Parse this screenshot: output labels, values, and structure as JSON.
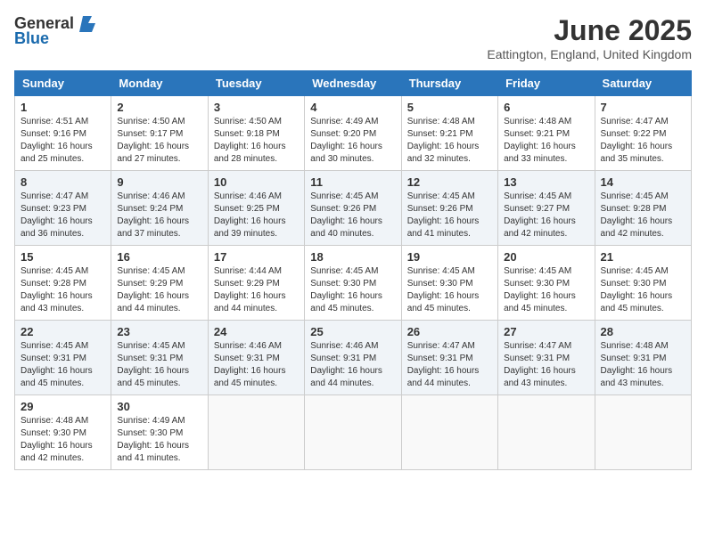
{
  "header": {
    "logo_general": "General",
    "logo_blue": "Blue",
    "month_year": "June 2025",
    "location": "Eattington, England, United Kingdom"
  },
  "weekdays": [
    "Sunday",
    "Monday",
    "Tuesday",
    "Wednesday",
    "Thursday",
    "Friday",
    "Saturday"
  ],
  "weeks": [
    [
      {
        "day": "1",
        "info": "Sunrise: 4:51 AM\nSunset: 9:16 PM\nDaylight: 16 hours and 25 minutes."
      },
      {
        "day": "2",
        "info": "Sunrise: 4:50 AM\nSunset: 9:17 PM\nDaylight: 16 hours and 27 minutes."
      },
      {
        "day": "3",
        "info": "Sunrise: 4:50 AM\nSunset: 9:18 PM\nDaylight: 16 hours and 28 minutes."
      },
      {
        "day": "4",
        "info": "Sunrise: 4:49 AM\nSunset: 9:20 PM\nDaylight: 16 hours and 30 minutes."
      },
      {
        "day": "5",
        "info": "Sunrise: 4:48 AM\nSunset: 9:21 PM\nDaylight: 16 hours and 32 minutes."
      },
      {
        "day": "6",
        "info": "Sunrise: 4:48 AM\nSunset: 9:21 PM\nDaylight: 16 hours and 33 minutes."
      },
      {
        "day": "7",
        "info": "Sunrise: 4:47 AM\nSunset: 9:22 PM\nDaylight: 16 hours and 35 minutes."
      }
    ],
    [
      {
        "day": "8",
        "info": "Sunrise: 4:47 AM\nSunset: 9:23 PM\nDaylight: 16 hours and 36 minutes."
      },
      {
        "day": "9",
        "info": "Sunrise: 4:46 AM\nSunset: 9:24 PM\nDaylight: 16 hours and 37 minutes."
      },
      {
        "day": "10",
        "info": "Sunrise: 4:46 AM\nSunset: 9:25 PM\nDaylight: 16 hours and 39 minutes."
      },
      {
        "day": "11",
        "info": "Sunrise: 4:45 AM\nSunset: 9:26 PM\nDaylight: 16 hours and 40 minutes."
      },
      {
        "day": "12",
        "info": "Sunrise: 4:45 AM\nSunset: 9:26 PM\nDaylight: 16 hours and 41 minutes."
      },
      {
        "day": "13",
        "info": "Sunrise: 4:45 AM\nSunset: 9:27 PM\nDaylight: 16 hours and 42 minutes."
      },
      {
        "day": "14",
        "info": "Sunrise: 4:45 AM\nSunset: 9:28 PM\nDaylight: 16 hours and 42 minutes."
      }
    ],
    [
      {
        "day": "15",
        "info": "Sunrise: 4:45 AM\nSunset: 9:28 PM\nDaylight: 16 hours and 43 minutes."
      },
      {
        "day": "16",
        "info": "Sunrise: 4:45 AM\nSunset: 9:29 PM\nDaylight: 16 hours and 44 minutes."
      },
      {
        "day": "17",
        "info": "Sunrise: 4:44 AM\nSunset: 9:29 PM\nDaylight: 16 hours and 44 minutes."
      },
      {
        "day": "18",
        "info": "Sunrise: 4:45 AM\nSunset: 9:30 PM\nDaylight: 16 hours and 45 minutes."
      },
      {
        "day": "19",
        "info": "Sunrise: 4:45 AM\nSunset: 9:30 PM\nDaylight: 16 hours and 45 minutes."
      },
      {
        "day": "20",
        "info": "Sunrise: 4:45 AM\nSunset: 9:30 PM\nDaylight: 16 hours and 45 minutes."
      },
      {
        "day": "21",
        "info": "Sunrise: 4:45 AM\nSunset: 9:30 PM\nDaylight: 16 hours and 45 minutes."
      }
    ],
    [
      {
        "day": "22",
        "info": "Sunrise: 4:45 AM\nSunset: 9:31 PM\nDaylight: 16 hours and 45 minutes."
      },
      {
        "day": "23",
        "info": "Sunrise: 4:45 AM\nSunset: 9:31 PM\nDaylight: 16 hours and 45 minutes."
      },
      {
        "day": "24",
        "info": "Sunrise: 4:46 AM\nSunset: 9:31 PM\nDaylight: 16 hours and 45 minutes."
      },
      {
        "day": "25",
        "info": "Sunrise: 4:46 AM\nSunset: 9:31 PM\nDaylight: 16 hours and 44 minutes."
      },
      {
        "day": "26",
        "info": "Sunrise: 4:47 AM\nSunset: 9:31 PM\nDaylight: 16 hours and 44 minutes."
      },
      {
        "day": "27",
        "info": "Sunrise: 4:47 AM\nSunset: 9:31 PM\nDaylight: 16 hours and 43 minutes."
      },
      {
        "day": "28",
        "info": "Sunrise: 4:48 AM\nSunset: 9:31 PM\nDaylight: 16 hours and 43 minutes."
      }
    ],
    [
      {
        "day": "29",
        "info": "Sunrise: 4:48 AM\nSunset: 9:30 PM\nDaylight: 16 hours and 42 minutes."
      },
      {
        "day": "30",
        "info": "Sunrise: 4:49 AM\nSunset: 9:30 PM\nDaylight: 16 hours and 41 minutes."
      },
      null,
      null,
      null,
      null,
      null
    ]
  ]
}
